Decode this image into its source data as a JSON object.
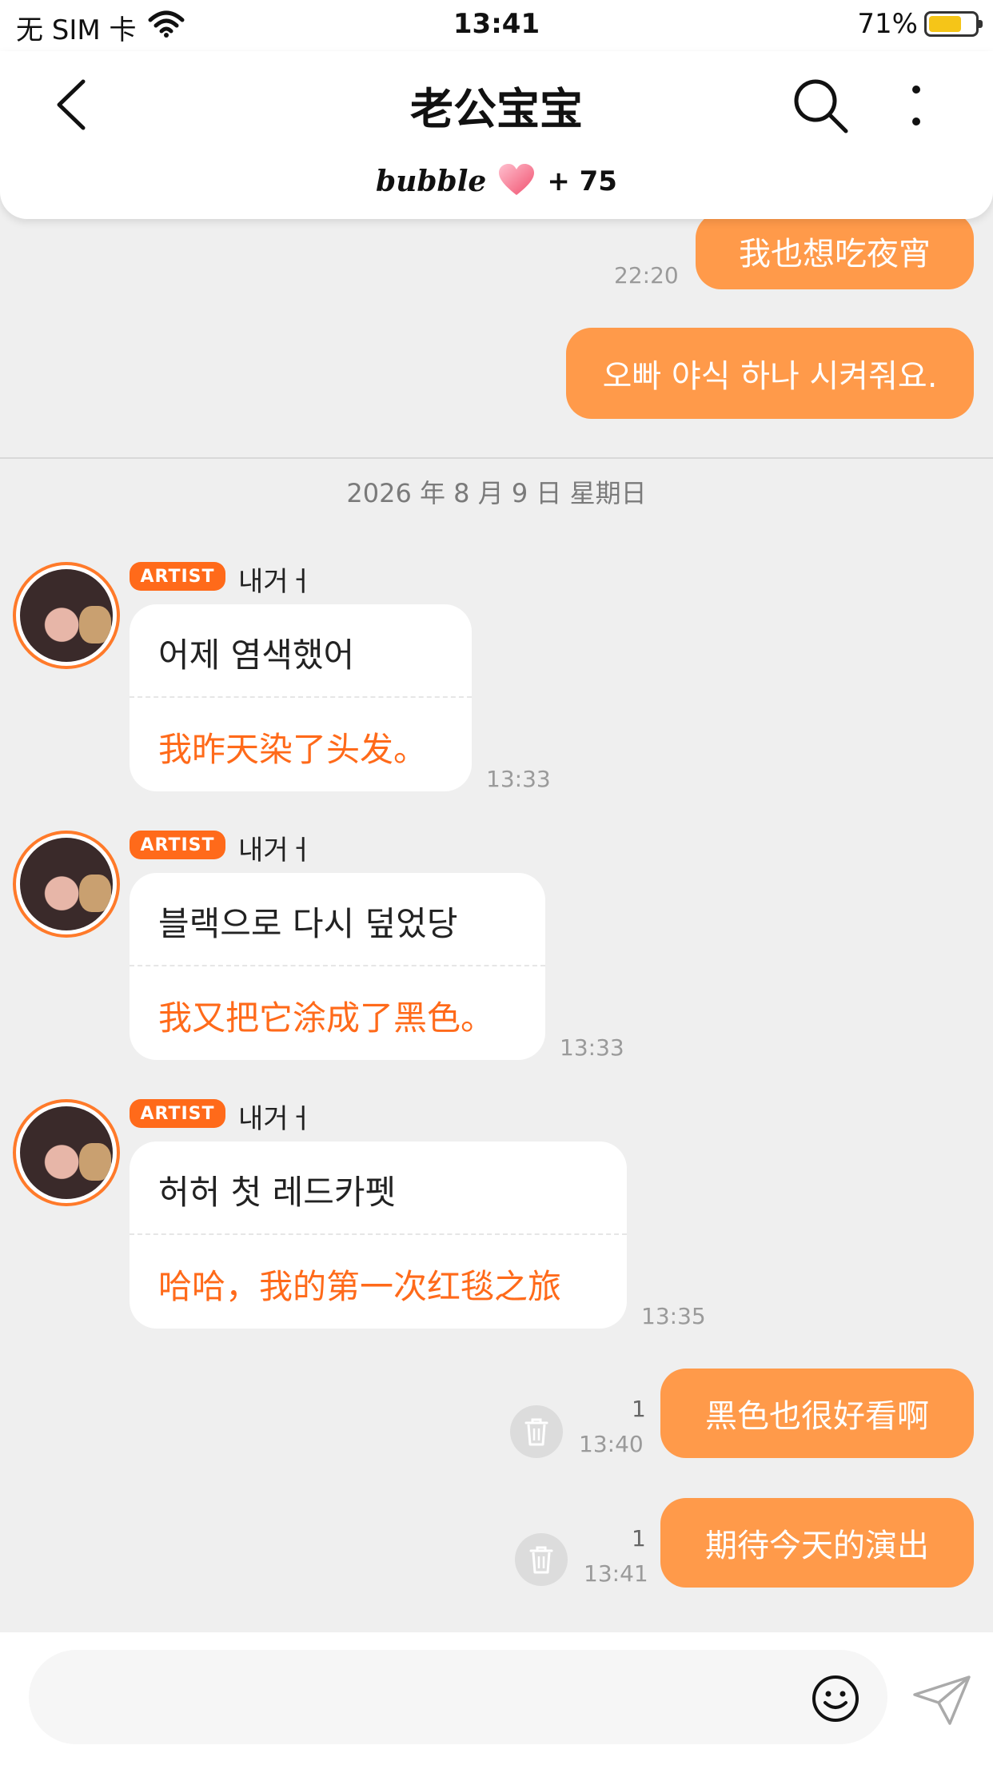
{
  "status_bar": {
    "carrier": "无 SIM 卡",
    "time": "13:41",
    "battery": "71%"
  },
  "header": {
    "title": "老公宝宝",
    "bubble_brand": "bubble",
    "bubble_count": "+ 75"
  },
  "messages_before": [
    {
      "text": "我也想吃夜宵",
      "time": "22:20"
    },
    {
      "text": "오빠 야식 하나 시켜줘요."
    }
  ],
  "date_separator": "2026 年 8 月 9 日 星期日",
  "artist_badge": "ARTIST",
  "artist_name": "내거ㅓ",
  "artist_messages": [
    {
      "ko": "어제 염색했어",
      "zh": "我昨天染了头发。",
      "time": "13:33"
    },
    {
      "ko": "블랙으로 다시 덮었당",
      "zh": "我又把它涂成了黑色。",
      "time": "13:33"
    },
    {
      "ko": "허허 첫 레드카펫",
      "zh": "哈哈，我的第一次红毯之旅",
      "time": "13:35"
    }
  ],
  "my_messages": [
    {
      "text": "黑色也很好看啊",
      "read_count": "1",
      "time": "13:40"
    },
    {
      "text": "期待今天的演出",
      "read_count": "1",
      "time": "13:41"
    }
  ],
  "input": {
    "placeholder": ""
  },
  "colors": {
    "accent": "#ff9a4a",
    "artist_accent": "#ff6a1a",
    "background": "#efefef"
  }
}
